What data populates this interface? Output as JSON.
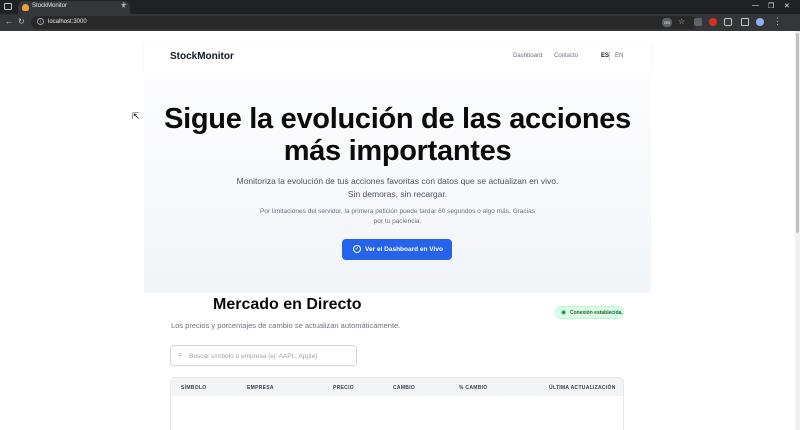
{
  "browser": {
    "tab_title": "StockMonitor",
    "tab_close": "✕",
    "new_tab": "+",
    "url": "localhost:3000",
    "badge": "GB",
    "window_controls": [
      "—",
      "❐",
      "✕"
    ]
  },
  "header": {
    "logo": "StockMonitor",
    "nav": [
      "Dashboard",
      "Contacto"
    ],
    "languages": [
      "ES",
      "EN"
    ],
    "active_language": "ES"
  },
  "hero": {
    "title_line1": "Sigue la evolución de las acciones",
    "title_line2": "más importantes",
    "subtitle_line1": "Monitoriza la evolución de tus acciones favoritas con datos que se actualizan en vivo.",
    "subtitle_line2": "Sin demoras, sin recargar.",
    "note_line1": "Por limitaciones del servidor, la primera petición puede tardar 60 segundos o algo más. Gracias",
    "note_line2": "por tu paciencia.",
    "cta_label": "Ver el Dashboard en Vivo"
  },
  "market": {
    "title": "Mercado en Directo",
    "subtitle": "Los precios y porcentajes de cambio se actualizan automáticamente.",
    "status": "Conexión establecida.",
    "search_placeholder": "Buscar símbolo o empresa (ej: AAPL, Apple)",
    "columns": [
      "SÍMBOLO",
      "EMPRESA",
      "PRECIO",
      "CAMBIO",
      "% CAMBIO",
      "ÚLTIMA ACTUALIZACIÓN"
    ]
  },
  "colors": {
    "accent": "#2563eb",
    "status_bg": "#dcfce7",
    "status_text": "#166534"
  }
}
